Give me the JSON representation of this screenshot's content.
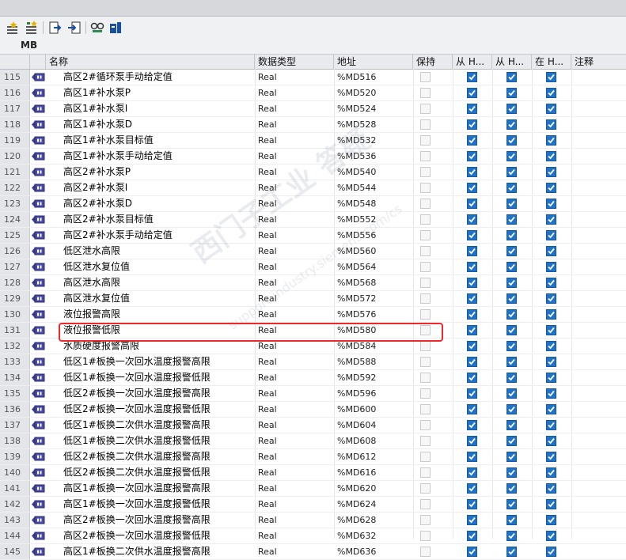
{
  "tab": "MB",
  "columns": [
    "名称",
    "数据类型",
    "地址",
    "保持",
    "从 H...",
    "从 H...",
    "在 H...",
    "注释"
  ],
  "watermark": {
    "main": "西门子工业  答疑",
    "sub": "support.industry.siemens.com/cs"
  },
  "rows": [
    {
      "n": "115",
      "name": "高区2#循环泵手动给定值",
      "type": "Real",
      "addr": "%MD516",
      "retain": false,
      "c1": true,
      "c2": true,
      "c3": true
    },
    {
      "n": "116",
      "name": "高区1#补水泵P",
      "type": "Real",
      "addr": "%MD520",
      "retain": false,
      "c1": true,
      "c2": true,
      "c3": true
    },
    {
      "n": "117",
      "name": "高区1#补水泵I",
      "type": "Real",
      "addr": "%MD524",
      "retain": false,
      "c1": true,
      "c2": true,
      "c3": true
    },
    {
      "n": "118",
      "name": "高区1#补水泵D",
      "type": "Real",
      "addr": "%MD528",
      "retain": false,
      "c1": true,
      "c2": true,
      "c3": true
    },
    {
      "n": "119",
      "name": "高区1#补水泵目标值",
      "type": "Real",
      "addr": "%MD532",
      "retain": false,
      "c1": true,
      "c2": true,
      "c3": true
    },
    {
      "n": "120",
      "name": "高区1#补水泵手动给定值",
      "type": "Real",
      "addr": "%MD536",
      "retain": false,
      "c1": true,
      "c2": true,
      "c3": true
    },
    {
      "n": "121",
      "name": "高区2#补水泵P",
      "type": "Real",
      "addr": "%MD540",
      "retain": false,
      "c1": true,
      "c2": true,
      "c3": true
    },
    {
      "n": "122",
      "name": "高区2#补水泵I",
      "type": "Real",
      "addr": "%MD544",
      "retain": false,
      "c1": true,
      "c2": true,
      "c3": true
    },
    {
      "n": "123",
      "name": "高区2#补水泵D",
      "type": "Real",
      "addr": "%MD548",
      "retain": false,
      "c1": true,
      "c2": true,
      "c3": true
    },
    {
      "n": "124",
      "name": "高区2#补水泵目标值",
      "type": "Real",
      "addr": "%MD552",
      "retain": false,
      "c1": true,
      "c2": true,
      "c3": true
    },
    {
      "n": "125",
      "name": "高区2#补水泵手动给定值",
      "type": "Real",
      "addr": "%MD556",
      "retain": false,
      "c1": true,
      "c2": true,
      "c3": true
    },
    {
      "n": "126",
      "name": "低区泄水高限",
      "type": "Real",
      "addr": "%MD560",
      "retain": false,
      "c1": true,
      "c2": true,
      "c3": true
    },
    {
      "n": "127",
      "name": "低区泄水复位值",
      "type": "Real",
      "addr": "%MD564",
      "retain": false,
      "c1": true,
      "c2": true,
      "c3": true
    },
    {
      "n": "128",
      "name": "高区泄水高限",
      "type": "Real",
      "addr": "%MD568",
      "retain": false,
      "c1": true,
      "c2": true,
      "c3": true
    },
    {
      "n": "129",
      "name": "高区泄水复位值",
      "type": "Real",
      "addr": "%MD572",
      "retain": false,
      "c1": true,
      "c2": true,
      "c3": true
    },
    {
      "n": "130",
      "name": "液位报警高限",
      "type": "Real",
      "addr": "%MD576",
      "retain": false,
      "c1": true,
      "c2": true,
      "c3": true
    },
    {
      "n": "131",
      "name": "液位报警低限",
      "type": "Real",
      "addr": "%MD580",
      "retain": false,
      "c1": true,
      "c2": true,
      "c3": true
    },
    {
      "n": "132",
      "name": "水质硬度报警高限",
      "type": "Real",
      "addr": "%MD584",
      "retain": false,
      "c1": true,
      "c2": true,
      "c3": true
    },
    {
      "n": "133",
      "name": "低区1#板换一次回水温度报警高限",
      "type": "Real",
      "addr": "%MD588",
      "retain": false,
      "c1": true,
      "c2": true,
      "c3": true
    },
    {
      "n": "134",
      "name": "低区1#板换一次回水温度报警低限",
      "type": "Real",
      "addr": "%MD592",
      "retain": false,
      "c1": true,
      "c2": true,
      "c3": true
    },
    {
      "n": "135",
      "name": "低区2#板换一次回水温度报警高限",
      "type": "Real",
      "addr": "%MD596",
      "retain": false,
      "c1": true,
      "c2": true,
      "c3": true
    },
    {
      "n": "136",
      "name": "低区2#板换一次回水温度报警低限",
      "type": "Real",
      "addr": "%MD600",
      "retain": false,
      "c1": true,
      "c2": true,
      "c3": true
    },
    {
      "n": "137",
      "name": "低区1#板换二次供水温度报警高限",
      "type": "Real",
      "addr": "%MD604",
      "retain": false,
      "c1": true,
      "c2": true,
      "c3": true
    },
    {
      "n": "138",
      "name": "低区1#板换二次供水温度报警低限",
      "type": "Real",
      "addr": "%MD608",
      "retain": false,
      "c1": true,
      "c2": true,
      "c3": true
    },
    {
      "n": "139",
      "name": "低区2#板换二次供水温度报警高限",
      "type": "Real",
      "addr": "%MD612",
      "retain": false,
      "c1": true,
      "c2": true,
      "c3": true
    },
    {
      "n": "140",
      "name": "低区2#板换二次供水温度报警低限",
      "type": "Real",
      "addr": "%MD616",
      "retain": false,
      "c1": true,
      "c2": true,
      "c3": true
    },
    {
      "n": "141",
      "name": "高区1#板换一次回水温度报警高限",
      "type": "Real",
      "addr": "%MD620",
      "retain": false,
      "c1": true,
      "c2": true,
      "c3": true
    },
    {
      "n": "142",
      "name": "高区1#板换一次回水温度报警低限",
      "type": "Real",
      "addr": "%MD624",
      "retain": false,
      "c1": true,
      "c2": true,
      "c3": true
    },
    {
      "n": "143",
      "name": "高区2#板换一次回水温度报警高限",
      "type": "Real",
      "addr": "%MD628",
      "retain": false,
      "c1": true,
      "c2": true,
      "c3": true
    },
    {
      "n": "144",
      "name": "高区2#板换一次回水温度报警低限",
      "type": "Real",
      "addr": "%MD632",
      "retain": false,
      "c1": true,
      "c2": true,
      "c3": true
    },
    {
      "n": "145",
      "name": "高区1#板换二次供水温度报警高限",
      "type": "Real",
      "addr": "%MD636",
      "retain": false,
      "c1": true,
      "c2": true,
      "c3": true
    }
  ]
}
